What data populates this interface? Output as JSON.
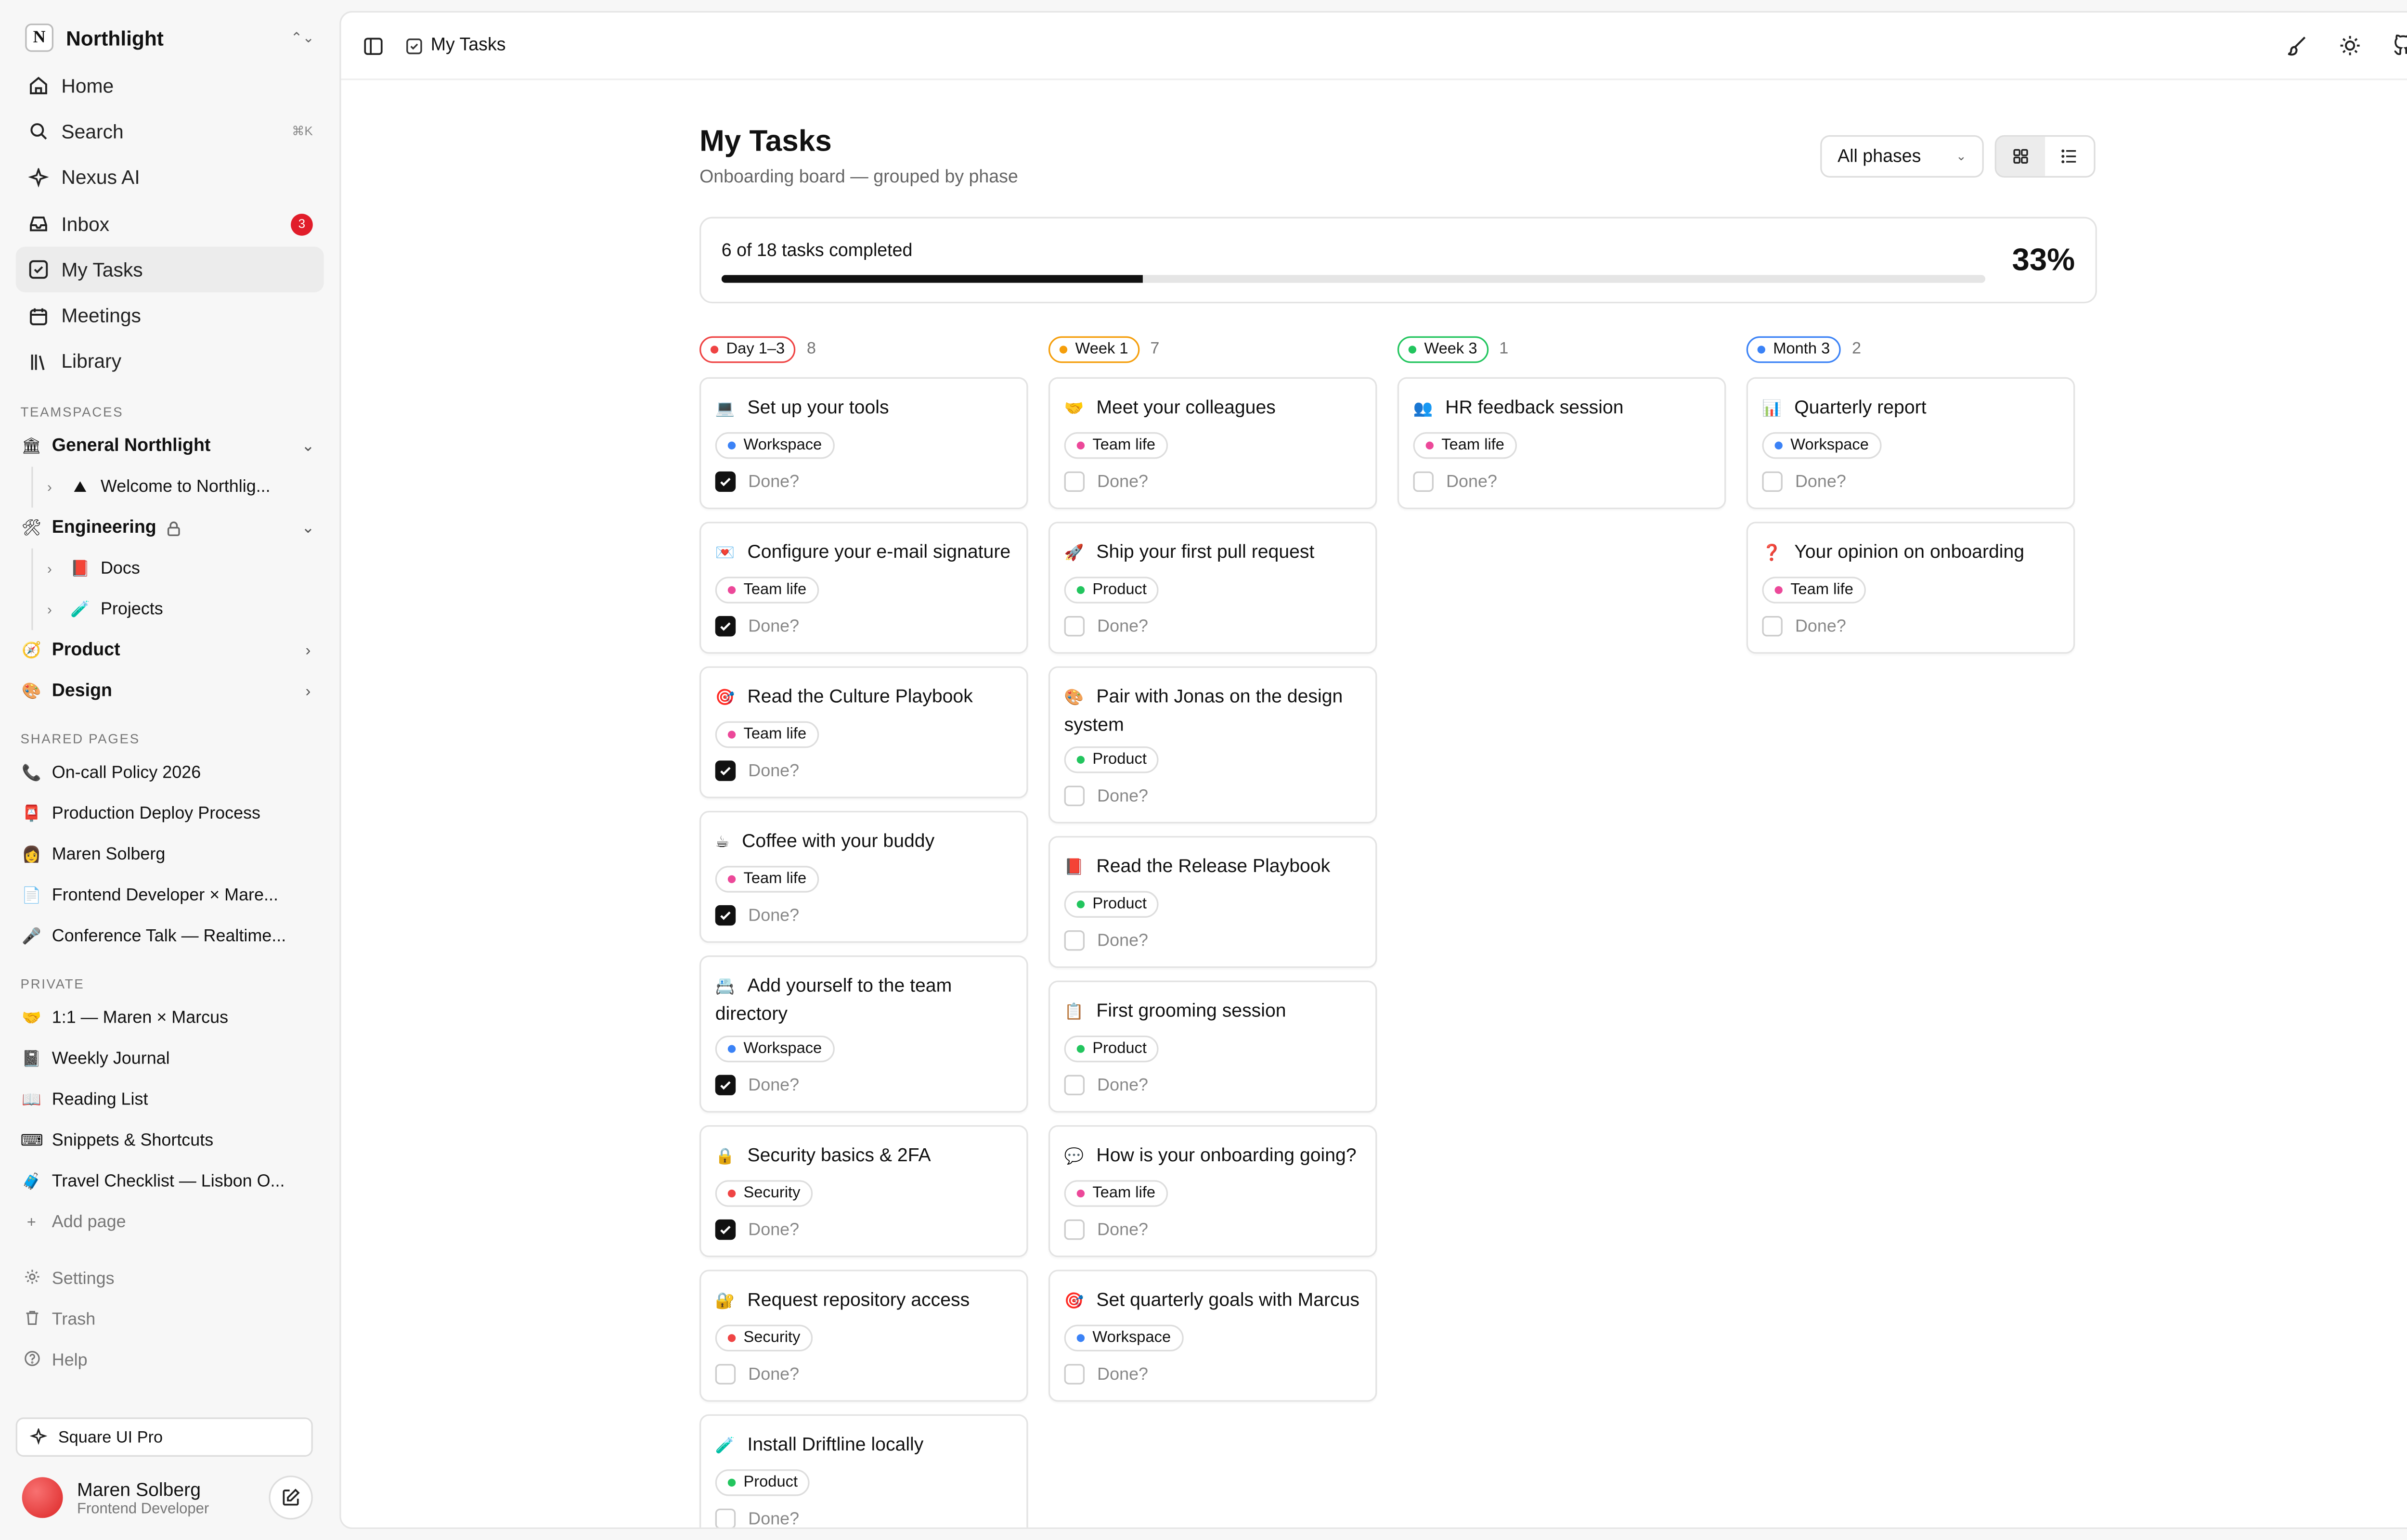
{
  "workspace": {
    "logo": "N",
    "name": "Northlight"
  },
  "nav": [
    {
      "name": "home",
      "label": "Home",
      "icon": "house-icon"
    },
    {
      "name": "search",
      "label": "Search",
      "icon": "search-icon",
      "shortcut": "⌘K"
    },
    {
      "name": "nexus-ai",
      "label": "Nexus AI",
      "icon": "sparkle-icon"
    },
    {
      "name": "inbox",
      "label": "Inbox",
      "icon": "inbox-icon",
      "badge": "3"
    },
    {
      "name": "my-tasks",
      "label": "My Tasks",
      "icon": "checkbox-icon",
      "active": true
    },
    {
      "name": "meetings",
      "label": "Meetings",
      "icon": "calendar-icon"
    },
    {
      "name": "library",
      "label": "Library",
      "icon": "library-icon"
    }
  ],
  "teamspaces": {
    "title": "TEAMSPACES",
    "general": {
      "emoji": "🏛",
      "label": "General Northlight",
      "child": {
        "emoji": "⛰",
        "label": "Welcome to Northlig..."
      }
    },
    "engineering": {
      "emoji": "🛠",
      "label": "Engineering",
      "children": [
        {
          "emoji": "📕",
          "label": "Docs"
        },
        {
          "emoji": "🧪",
          "label": "Projects"
        }
      ]
    },
    "product": {
      "emoji": "🧭",
      "label": "Product"
    },
    "design": {
      "emoji": "🎨",
      "label": "Design"
    }
  },
  "shared": {
    "title": "SHARED PAGES",
    "items": [
      {
        "emoji": "📞",
        "label": "On-call Policy 2026"
      },
      {
        "emoji": "📮",
        "label": "Production Deploy Process"
      },
      {
        "emoji": "👩",
        "label": "Maren Solberg"
      },
      {
        "emoji": "📄",
        "label": "Frontend Developer × Mare..."
      },
      {
        "emoji": "🎤",
        "label": "Conference Talk — Realtime..."
      }
    ]
  },
  "private": {
    "title": "PRIVATE",
    "items": [
      {
        "emoji": "🤝",
        "label": "1:1 — Maren × Marcus"
      },
      {
        "emoji": "📓",
        "label": "Weekly Journal"
      },
      {
        "emoji": "📖",
        "label": "Reading List"
      },
      {
        "emoji": "⌨",
        "label": "Snippets & Shortcuts"
      },
      {
        "emoji": "🧳",
        "label": "Travel Checklist — Lisbon O..."
      }
    ],
    "add_page": "Add page"
  },
  "footer_nav": [
    {
      "label": "Settings",
      "icon": "gear-icon"
    },
    {
      "label": "Trash",
      "icon": "trash-icon"
    },
    {
      "label": "Help",
      "icon": "help-icon"
    }
  ],
  "pro_label": "Square UI Pro",
  "user": {
    "name": "Maren Solberg",
    "role": "Frontend Developer"
  },
  "topbar": {
    "crumb": "My Tasks"
  },
  "page": {
    "title": "My Tasks",
    "subtitle": "Onboarding board — grouped by phase",
    "phase_filter": "All phases"
  },
  "progress": {
    "label": "6 of 18 tasks completed",
    "percent_label": "33%",
    "fraction": 0.333
  },
  "done_label": "Done?",
  "colors": {
    "Workspace": "#3b82f6",
    "Team life": "#ec4899",
    "Product": "#22c55e",
    "Security": "#ef4444"
  },
  "columns": [
    {
      "phase": "Day 1–3",
      "count": "8",
      "color": "#ef4444",
      "cards": [
        {
          "emoji": "💻",
          "title": "Set up your tools",
          "tag": "Workspace",
          "done": true
        },
        {
          "emoji": "💌",
          "title": "Configure your e-mail signature",
          "tag": "Team life",
          "done": true
        },
        {
          "emoji": "🎯",
          "title": "Read the Culture Playbook",
          "tag": "Team life",
          "done": true
        },
        {
          "emoji": "☕",
          "title": "Coffee with your buddy",
          "tag": "Team life",
          "done": true
        },
        {
          "emoji": "📇",
          "title": "Add yourself to the team directory",
          "tag": "Workspace",
          "done": true
        },
        {
          "emoji": "🔒",
          "title": "Security basics & 2FA",
          "tag": "Security",
          "done": true
        },
        {
          "emoji": "🔐",
          "title": "Request repository access",
          "tag": "Security",
          "done": false
        },
        {
          "emoji": "🧪",
          "title": "Install Driftline locally",
          "tag": "Product",
          "done": false
        }
      ]
    },
    {
      "phase": "Week 1",
      "count": "7",
      "color": "#f59e0b",
      "cards": [
        {
          "emoji": "🤝",
          "title": "Meet your colleagues",
          "tag": "Team life",
          "done": false
        },
        {
          "emoji": "🚀",
          "title": "Ship your first pull request",
          "tag": "Product",
          "done": false
        },
        {
          "emoji": "🎨",
          "title": "Pair with Jonas on the design system",
          "tag": "Product",
          "done": false
        },
        {
          "emoji": "📕",
          "title": "Read the Release Playbook",
          "tag": "Product",
          "done": false
        },
        {
          "emoji": "📋",
          "title": "First grooming session",
          "tag": "Product",
          "done": false
        },
        {
          "emoji": "💬",
          "title": "How is your onboarding going?",
          "tag": "Team life",
          "done": false
        },
        {
          "emoji": "🎯",
          "title": "Set quarterly goals with Marcus",
          "tag": "Workspace",
          "done": false
        }
      ]
    },
    {
      "phase": "Week 3",
      "count": "1",
      "color": "#22c55e",
      "cards": [
        {
          "emoji": "👥",
          "title": "HR feedback session",
          "tag": "Team life",
          "done": false
        }
      ]
    },
    {
      "phase": "Month 3",
      "count": "2",
      "color": "#3b82f6",
      "cards": [
        {
          "emoji": "📊",
          "title": "Quarterly report",
          "tag": "Workspace",
          "done": false
        },
        {
          "emoji": "❓",
          "title": "Your opinion on onboarding",
          "tag": "Team life",
          "done": false
        }
      ]
    }
  ]
}
